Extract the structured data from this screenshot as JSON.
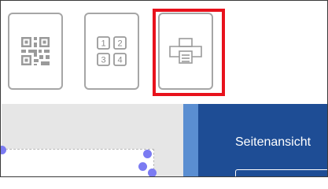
{
  "toolbar": {
    "buttons": [
      {
        "icon": "qr-code-icon"
      },
      {
        "icon": "grid-numbers-icon",
        "cells": [
          "1",
          "2",
          "3",
          "4"
        ]
      },
      {
        "icon": "print-icon",
        "selected": true
      }
    ],
    "highlight_color": "#e8121c"
  },
  "panel": {
    "title": "Seitenansicht",
    "background": "#1e4d95"
  }
}
